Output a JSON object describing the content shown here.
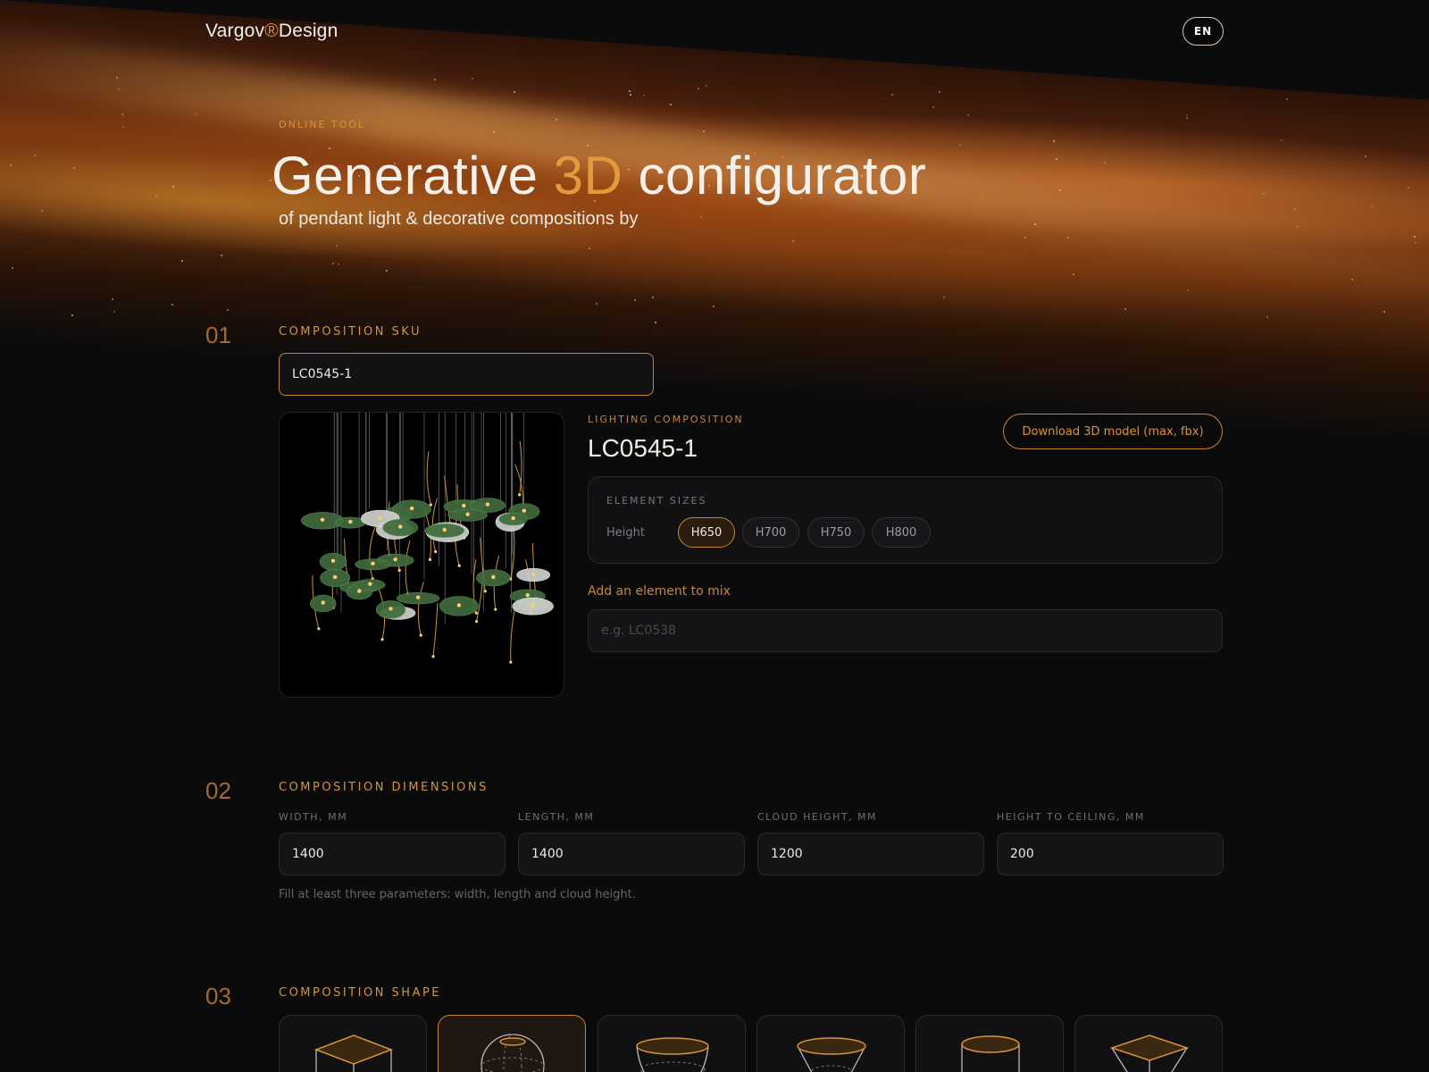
{
  "header": {
    "logo_main": "Vargov",
    "logo_reg": "®",
    "logo_tail": "Design",
    "lang": "EN"
  },
  "hero": {
    "eyebrow": "ONLINE TOOL",
    "title_pre": "Generative ",
    "title_accent": "3D",
    "title_post": " configurator",
    "subtitle": "of pendant light & decorative compositions by"
  },
  "step1": {
    "number": "01",
    "label": "COMPOSITION SKU",
    "sku_value": "LC0545-1",
    "composition_label": "LIGHTING COMPOSITION",
    "composition_name": "LC0545-1",
    "download_label": "Download 3D model (max, fbx)",
    "sizes_title": "ELEMENT SIZES",
    "height_label": "Height",
    "sizes": [
      "H650",
      "H700",
      "H750",
      "H800"
    ],
    "selected_size": "H650",
    "mix_label": "Add an element to mix",
    "mix_placeholder": "e.g. LC0538"
  },
  "step2": {
    "number": "02",
    "label": "COMPOSITION DIMENSIONS",
    "fields": [
      {
        "label": "WIDTH, MM",
        "value": "1400"
      },
      {
        "label": "LENGTH, MM",
        "value": "1400"
      },
      {
        "label": "CLOUD HEIGHT, MM",
        "value": "1200"
      },
      {
        "label": "HEIGHT TO CEILING, MM",
        "value": "200"
      }
    ],
    "hint": "Fill at least three parameters: width, length and cloud height."
  },
  "step3": {
    "number": "03",
    "label": "COMPOSITION SHAPE",
    "shape_icons": [
      "cube-shape-icon",
      "sphere-shape-icon",
      "bowl-shape-icon",
      "cone-shape-icon",
      "cylinder-shape-icon",
      "pyramid-shape-icon"
    ],
    "selected_index": 1
  },
  "colors": {
    "accent": "#d7923a",
    "background": "#0b0b0c",
    "card": "#111113"
  }
}
